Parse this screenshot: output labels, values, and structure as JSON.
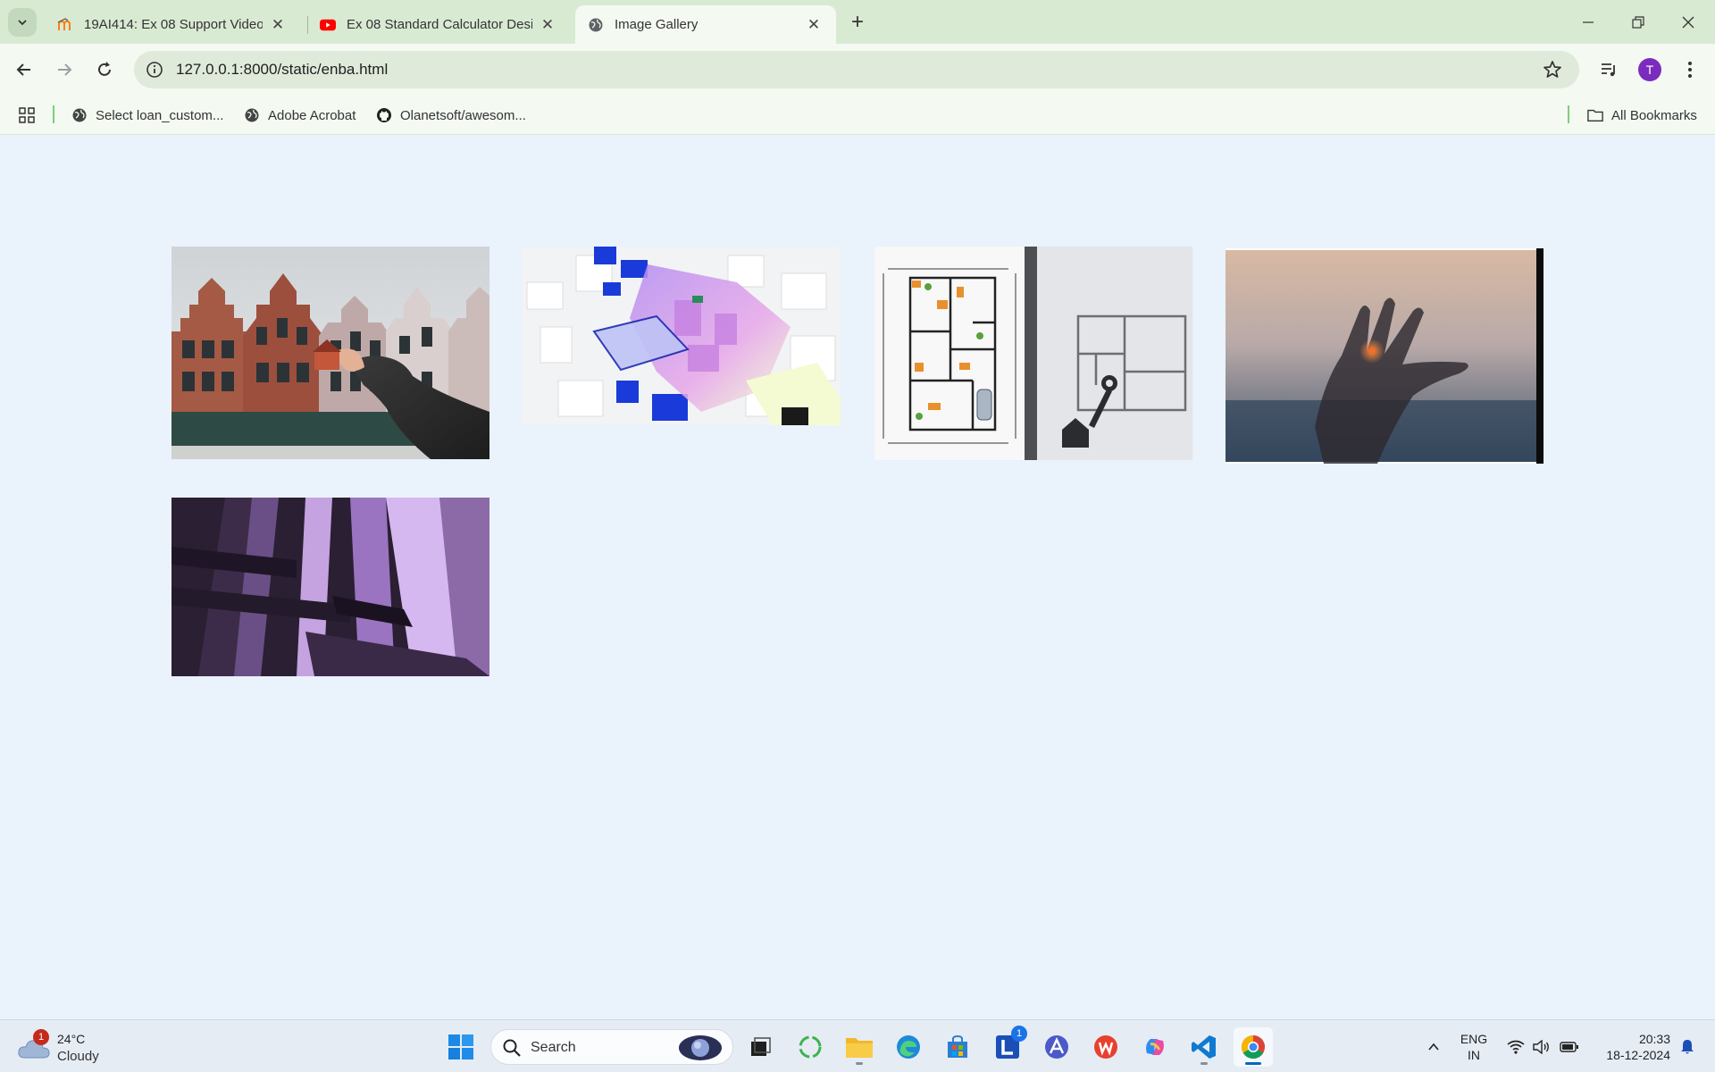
{
  "browser": {
    "tabs": [
      {
        "title": "19AI414: Ex 08 Support Video |",
        "icon": "moodle-icon"
      },
      {
        "title": "Ex 08 Standard Calculator Desig",
        "icon": "youtube-icon"
      },
      {
        "title": "Image Gallery",
        "icon": "globe-icon",
        "active": true
      }
    ],
    "url": "127.0.0.1:8000/static/enba.html",
    "profile_initial": "T",
    "bookmarks": [
      {
        "label": "Select loan_custom...",
        "icon": "globe-icon"
      },
      {
        "label": "Adobe Acrobat",
        "icon": "globe-icon"
      },
      {
        "label": "Olanetsoft/awesom...",
        "icon": "github-icon"
      }
    ],
    "all_bookmarks_label": "All Bookmarks"
  },
  "gallery": {
    "images": [
      {
        "subject": "stepped-gable brick facades with a hand holding a miniature house"
      },
      {
        "subject": "3D isometric city blocks in blue and purple glass"
      },
      {
        "subject": "architectural floor plan with a house key"
      },
      {
        "subject": "silhouette of a hand over a sunset cityscape"
      },
      {
        "subject": "abstract purple geometric 3D pillars"
      }
    ]
  },
  "taskbar": {
    "weather": {
      "temp": "24°C",
      "condition": "Cloudy",
      "badge": "1"
    },
    "search_label": "Search",
    "lang_line1": "ENG",
    "lang_line2": "IN",
    "time": "20:33",
    "date": "18-12-2024",
    "app_badge": "1"
  },
  "colors": {
    "tabstrip": "#d9ead3",
    "toolbar": "#f4f9f1",
    "page_background": "#eaf2fb",
    "taskbar": "#e6ecf4"
  }
}
